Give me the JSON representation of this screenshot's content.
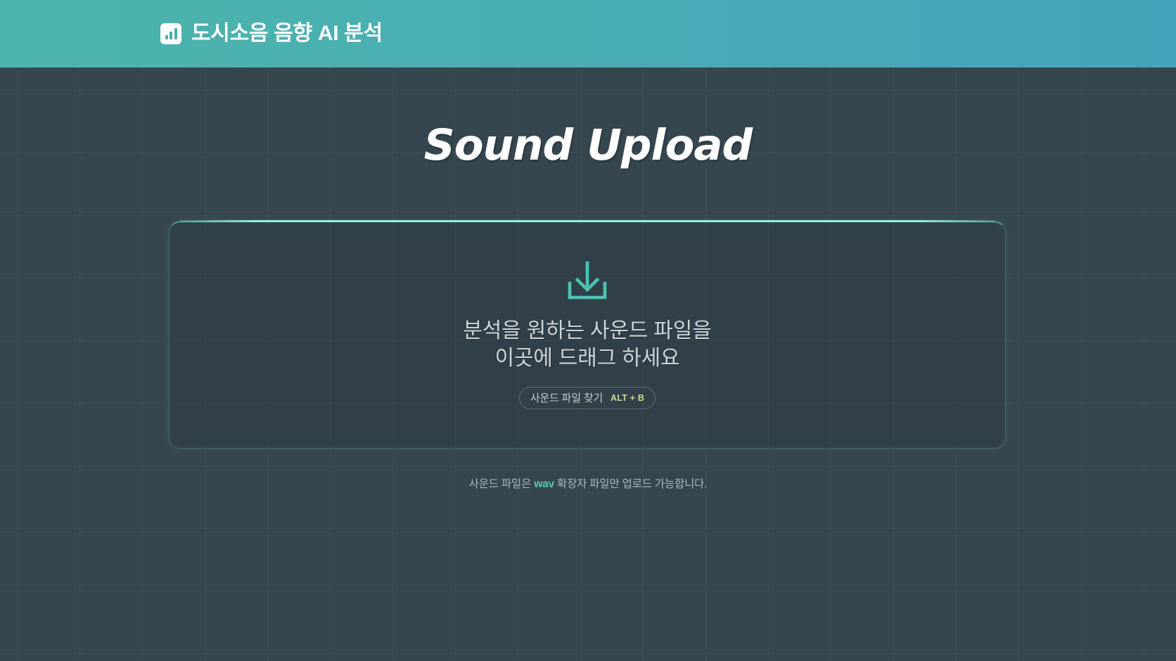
{
  "header": {
    "brand_icon": "bar-chart-icon",
    "title": "도시소음 음향 AI 분석",
    "gradient_from": "#4cb5ab",
    "gradient_to": "#45a3bb"
  },
  "main": {
    "page_title": "Sound Upload",
    "dropzone": {
      "icon": "download-tray-icon",
      "headline": "분석을 원하는 사운드 파일을\n이곳에 드래그 하세요",
      "browse_label": "사운드 파일 찾기",
      "browse_shortcut": "ALT + B",
      "border_color": "#76ded0"
    },
    "footnote": {
      "prefix": "사운드 파일은 ",
      "highlight": "wav",
      "suffix": " 확장자 파일만 업로드 가능합니다.",
      "highlight_color": "#58c9b9"
    }
  },
  "theme": {
    "page_background": "#36464e",
    "accent": "#4cb5ab",
    "grid_line": "rgba(120,190,190,0.075)"
  }
}
